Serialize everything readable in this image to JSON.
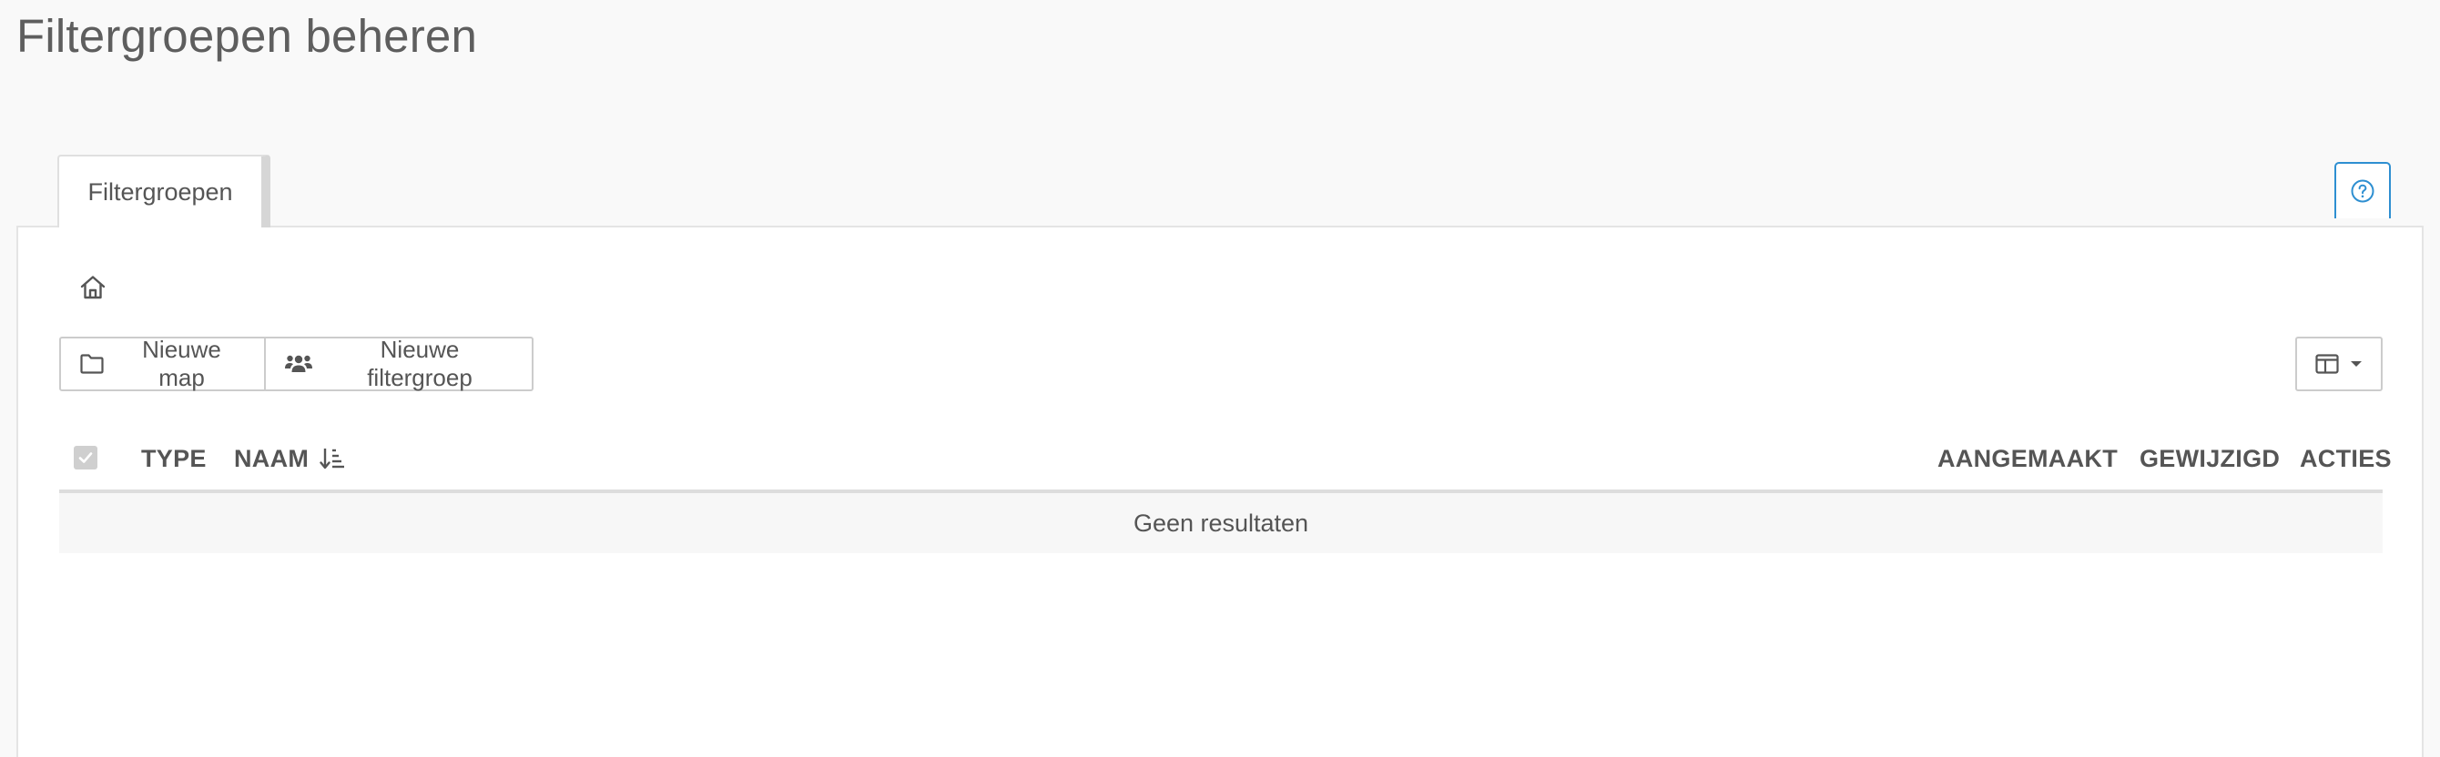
{
  "page": {
    "title": "Filtergroepen beheren"
  },
  "tabs": [
    {
      "label": "Filtergroepen",
      "active": true
    }
  ],
  "help": {
    "icon": "question-circle-icon"
  },
  "breadcrumb": {
    "icon": "home-icon"
  },
  "toolbar": {
    "new_map_label": "Nieuwe map",
    "new_map_icon": "folder-icon",
    "new_filtergroup_label": "Nieuwe filtergroep",
    "new_filtergroup_icon": "users-icon",
    "columns_icon": "columns-icon"
  },
  "table": {
    "columns": {
      "type": "TYPE",
      "naam": "NAAM",
      "aangemaakt": "AANGEMAAKT",
      "gewijzigd": "GEWIJZIGD",
      "acties": "ACTIES"
    },
    "sort_icon": "sort-ascending-icon",
    "empty_message": "Geen resultaten"
  },
  "colors": {
    "accent": "#2e8fd1",
    "background": "#f9f9f9",
    "panel": "#ffffff",
    "border": "#cccccc",
    "text": "#555555"
  }
}
